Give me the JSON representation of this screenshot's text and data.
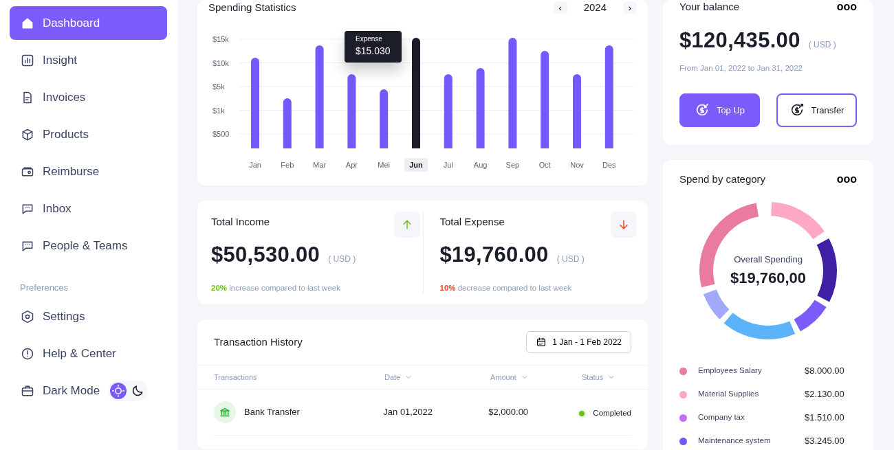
{
  "sidebar": {
    "items": [
      {
        "label": "Dashboard",
        "selected": true
      },
      {
        "label": "Insight",
        "selected": false
      },
      {
        "label": "Invoices",
        "selected": false
      },
      {
        "label": "Products",
        "selected": false
      },
      {
        "label": "Reimburse",
        "selected": false
      },
      {
        "label": "Inbox",
        "selected": false
      },
      {
        "label": "People & Teams",
        "selected": false
      }
    ],
    "preferences_heading": "Preferences",
    "preferences": [
      {
        "label": "Settings",
        "kind": "link"
      },
      {
        "label": "Help & Center",
        "kind": "link"
      },
      {
        "label": "Dark Mode",
        "kind": "toggle",
        "on": false
      }
    ]
  },
  "spending": {
    "title": "Spending Statistics",
    "year": "2024",
    "prev": "‹",
    "next": "›",
    "y_labels": [
      "$15k",
      "$10k",
      "$5k",
      "$1k",
      "$500"
    ],
    "months": [
      {
        "label": "Jan",
        "selected": false
      },
      {
        "label": "Feb",
        "selected": false
      },
      {
        "label": "Mar",
        "selected": false
      },
      {
        "label": "Apr",
        "selected": false
      },
      {
        "label": "Mei",
        "selected": false
      },
      {
        "label": "Jun",
        "selected": true
      },
      {
        "label": "Jul",
        "selected": false
      },
      {
        "label": "Aug",
        "selected": false
      },
      {
        "label": "Sep",
        "selected": false
      },
      {
        "label": "Oct",
        "selected": false
      },
      {
        "label": "Nov",
        "selected": false
      },
      {
        "label": "Des",
        "selected": false
      }
    ],
    "tooltip": {
      "label": "Expense",
      "value": "$15.030"
    }
  },
  "totals": [
    {
      "title": "Total Income",
      "amount": "$50,530.00",
      "currency": "( USD )",
      "kind": "up",
      "change": "20%",
      "note": "increase compared to last week"
    },
    {
      "title": "Total Expense",
      "amount": "$19,760.00",
      "currency": "( USD )",
      "kind": "down",
      "change": "10%",
      "note": "decrease compared to last week"
    }
  ],
  "transactions": {
    "title": "Transaction History",
    "date_range": "1 Jan - 1 Feb 2022",
    "columns": [
      "Transactions",
      "Date",
      "Amount",
      "Status"
    ],
    "rows": [
      {
        "name": "Bank Transfer",
        "date": "Jan 01,2022",
        "amount": "$2,000.00",
        "status": "Completed",
        "color": "#6cbf1c"
      }
    ]
  },
  "balance": {
    "title": "Your balance",
    "more": "ooo",
    "amount": "$120,435.00",
    "currency": "( USD )",
    "period": "From Jan 01, 2022 to Jan 31, 2022",
    "buttons": [
      {
        "label": "Top Up",
        "kind": "primary"
      },
      {
        "label": "Transfer",
        "kind": "outline"
      }
    ]
  },
  "category": {
    "title": "Spend by category",
    "more": "ooo",
    "center_label": "Overall Spending",
    "center_value": "$19,760,00",
    "legend": [
      {
        "label": "Employees Salary",
        "value": "$8.000.00",
        "color": "#e97aa0"
      },
      {
        "label": "Material Supplies",
        "value": "$2.130.00",
        "color": "#ffa8c5"
      },
      {
        "label": "Company tax",
        "value": "$1.510.00",
        "color": "#c46ef5"
      },
      {
        "label": "Maintenance system",
        "value": "$3.245.00",
        "color": "#7459fe"
      }
    ]
  }
}
